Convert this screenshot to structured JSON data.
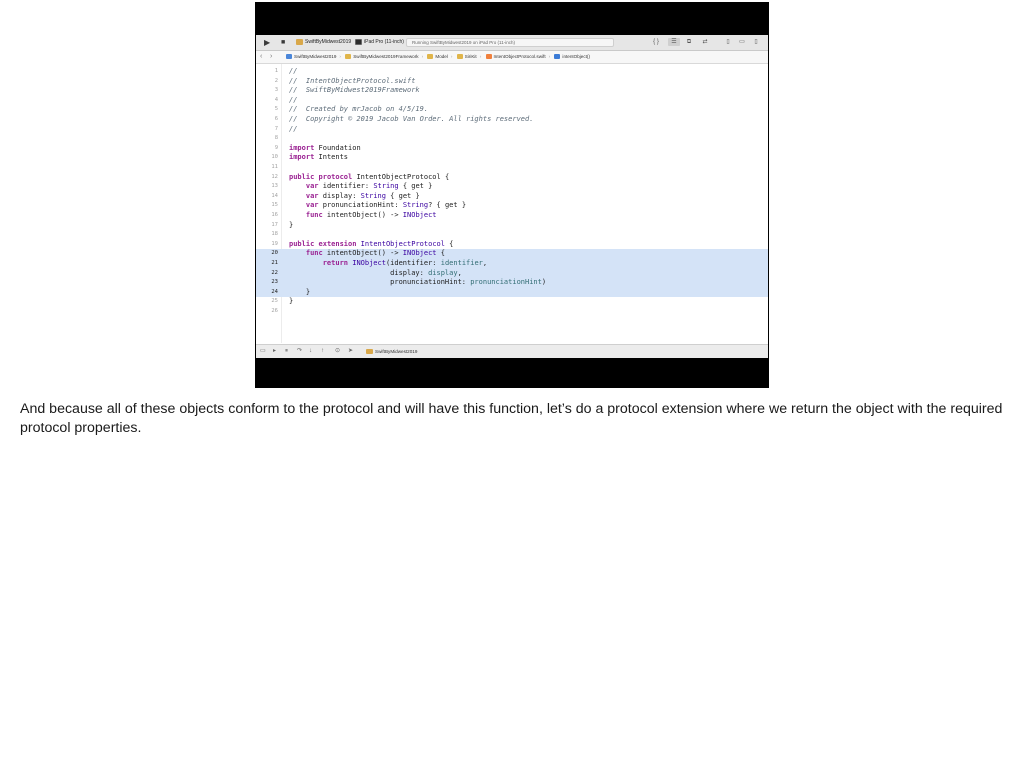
{
  "toolbar": {
    "run_icon": "play-icon",
    "stop_icon": "stop-icon",
    "scheme_label": "SwiftByMidwest2019",
    "device_label": "iPad Pro (11-inch)",
    "status_text": "Running SwiftByMidwest2019 on iPad Pro (11-inch)",
    "right_buttons": [
      "library-icon",
      "standard-editor-icon",
      "assistant-editor-icon",
      "version-editor-icon",
      "navigator-toggle-icon",
      "debug-toggle-icon",
      "inspector-toggle-icon"
    ]
  },
  "jumpbar": {
    "crumbs": [
      {
        "label": "SwiftByMidwest2019",
        "icon": "project-icon"
      },
      {
        "label": "SwiftByMidwest2019Framework",
        "icon": "folder-icon"
      },
      {
        "label": "Model",
        "icon": "folder-icon"
      },
      {
        "label": "SiriKit",
        "icon": "folder-icon"
      },
      {
        "label": "IntentObjectProtocol.swift",
        "icon": "swift-file-icon"
      },
      {
        "label": "intentObject()",
        "icon": "method-icon"
      }
    ]
  },
  "editor": {
    "highlighted_lines": [
      20,
      21,
      22,
      23,
      24
    ],
    "lines": [
      {
        "n": "1",
        "text": "//"
      },
      {
        "n": "2",
        "text": "//  IntentObjectProtocol.swift"
      },
      {
        "n": "3",
        "text": "//  SwiftByMidwest2019Framework"
      },
      {
        "n": "4",
        "text": "//"
      },
      {
        "n": "5",
        "text": "//  Created by mrJacob on 4/5/19."
      },
      {
        "n": "6",
        "text": "//  Copyright © 2019 Jacob Van Order. All rights reserved."
      },
      {
        "n": "7",
        "text": "//"
      },
      {
        "n": "8",
        "text": ""
      },
      {
        "n": "9",
        "text": "import Foundation"
      },
      {
        "n": "10",
        "text": "import Intents"
      },
      {
        "n": "11",
        "text": ""
      },
      {
        "n": "12",
        "text": "public protocol IntentObjectProtocol {"
      },
      {
        "n": "13",
        "text": "    var identifier: String { get }"
      },
      {
        "n": "14",
        "text": "    var display: String { get }"
      },
      {
        "n": "15",
        "text": "    var pronunciationHint: String? { get }"
      },
      {
        "n": "16",
        "text": "    func intentObject() -> INObject"
      },
      {
        "n": "17",
        "text": "}"
      },
      {
        "n": "18",
        "text": ""
      },
      {
        "n": "19",
        "text": "public extension IntentObjectProtocol {"
      },
      {
        "n": "20",
        "text": "    func intentObject() -> INObject {"
      },
      {
        "n": "21",
        "text": "        return INObject(identifier: identifier,"
      },
      {
        "n": "22",
        "text": "                        display: display,"
      },
      {
        "n": "23",
        "text": "                        pronunciationHint: pronunciationHint)"
      },
      {
        "n": "24",
        "text": "    }"
      },
      {
        "n": "25",
        "text": "}"
      },
      {
        "n": "26",
        "text": ""
      }
    ]
  },
  "debugbar": {
    "target_label": "SwiftByMidwest2019"
  },
  "caption": "And because all of these objects conform to the protocol and will have this function, let’s do a protocol extension where we return the object with the required protocol properties."
}
